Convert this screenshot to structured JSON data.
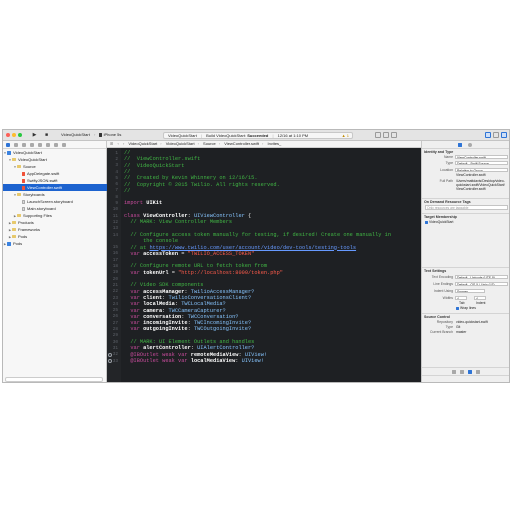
{
  "toolbar": {
    "scheme_target": "VideoQuickStart",
    "scheme_device": "iPhone 5s",
    "activity_app": "VideoQuickStart",
    "activity_status_prefix": "Build VideoQuickStart: ",
    "activity_status": "Succeeded",
    "activity_time": "12/16 at 1:10 PM",
    "warning_count": "1"
  },
  "navigator": {
    "rows": [
      {
        "label": "VideoQuickStart",
        "icon": "project-icon"
      },
      {
        "label": "VideoQuickStart",
        "icon": "folder-icon"
      },
      {
        "label": "Source",
        "icon": "folder-icon"
      },
      {
        "label": "AppDelegate.swift",
        "icon": "swift-file-icon"
      },
      {
        "label": "SwiftyJSON.swift",
        "icon": "swift-file-icon"
      },
      {
        "label": "ViewController.swift",
        "icon": "swift-file-icon"
      },
      {
        "label": "Storyboards",
        "icon": "folder-icon"
      },
      {
        "label": "LaunchScreen.storyboard",
        "icon": "file-icon"
      },
      {
        "label": "Main.storyboard",
        "icon": "file-icon"
      },
      {
        "label": "Supporting Files",
        "icon": "folder-icon"
      },
      {
        "label": "Products",
        "icon": "folder-icon"
      },
      {
        "label": "Frameworks",
        "icon": "folder-icon"
      },
      {
        "label": "Pods",
        "icon": "project-icon"
      },
      {
        "label": "Pods",
        "icon": "folder-icon"
      }
    ]
  },
  "jumpbar": {
    "items": [
      "VideoQuickStart",
      "VideoQuickStart",
      "Source",
      "ViewController.swift",
      "Invites_"
    ]
  },
  "editor": {
    "lines": [
      [
        {
          "t": "//",
          "c": "com"
        }
      ],
      [
        {
          "t": "//  ViewController.swift",
          "c": "com"
        }
      ],
      [
        {
          "t": "//  VideoQuickStart",
          "c": "com"
        }
      ],
      [
        {
          "t": "//",
          "c": "com"
        }
      ],
      [
        {
          "t": "//  Created by Kevin Whinnery on 12/16/15.",
          "c": "com"
        }
      ],
      [
        {
          "t": "//  Copyright © 2015 Twilio. All rights reserved.",
          "c": "com"
        }
      ],
      [
        {
          "t": "//",
          "c": "com"
        }
      ],
      [],
      [
        {
          "t": "import ",
          "c": "key"
        },
        {
          "t": "UIKit",
          "c": "bold"
        }
      ],
      [],
      [
        {
          "t": "class ",
          "c": "key"
        },
        {
          "t": "ViewController",
          "c": "bold"
        },
        {
          "t": ": ",
          "c": "ident"
        },
        {
          "t": "UIViewController",
          "c": "type"
        },
        {
          "t": " {",
          "c": "ident"
        }
      ],
      [
        {
          "t": "  // MARK: View Controller Members",
          "c": "com"
        }
      ],
      [],
      [
        {
          "t": "  // Configure access token manually for testing, if desired! Create one manually in",
          "c": "com"
        }
      ],
      [
        {
          "t": "      the console",
          "c": "com"
        }
      ],
      [
        {
          "t": "  // at ",
          "c": "com"
        },
        {
          "t": "https://www.twilio.com/user/account/video/dev-tools/testing-tools",
          "c": "link"
        }
      ],
      [
        {
          "t": "  var ",
          "c": "key"
        },
        {
          "t": "accessToken",
          "c": "bold"
        },
        {
          "t": " = ",
          "c": "ident"
        },
        {
          "t": "\"TWILIO_ACCESS_TOKEN\"",
          "c": "str"
        }
      ],
      [],
      [
        {
          "t": "  // Configure remote URL to fetch token from",
          "c": "com"
        }
      ],
      [
        {
          "t": "  var ",
          "c": "key"
        },
        {
          "t": "tokenUrl",
          "c": "bold"
        },
        {
          "t": " = ",
          "c": "ident"
        },
        {
          "t": "\"http://localhost:8000/token.php\"",
          "c": "str"
        }
      ],
      [],
      [
        {
          "t": "  // Video SDK components",
          "c": "com"
        }
      ],
      [
        {
          "t": "  var ",
          "c": "key"
        },
        {
          "t": "accessManager",
          "c": "bold"
        },
        {
          "t": ": ",
          "c": "ident"
        },
        {
          "t": "TwilioAccessManager?",
          "c": "type"
        }
      ],
      [
        {
          "t": "  var ",
          "c": "key"
        },
        {
          "t": "client",
          "c": "bold"
        },
        {
          "t": ": ",
          "c": "ident"
        },
        {
          "t": "TwilioConversationsClient?",
          "c": "type"
        }
      ],
      [
        {
          "t": "  var ",
          "c": "key"
        },
        {
          "t": "localMedia",
          "c": "bold"
        },
        {
          "t": ": ",
          "c": "ident"
        },
        {
          "t": "TWCLocalMedia?",
          "c": "type"
        }
      ],
      [
        {
          "t": "  var ",
          "c": "key"
        },
        {
          "t": "camera",
          "c": "bold"
        },
        {
          "t": ": ",
          "c": "ident"
        },
        {
          "t": "TWCCameraCapturer?",
          "c": "type"
        }
      ],
      [
        {
          "t": "  var ",
          "c": "key"
        },
        {
          "t": "conversation",
          "c": "bold"
        },
        {
          "t": ": ",
          "c": "ident"
        },
        {
          "t": "TWCConversation?",
          "c": "type"
        }
      ],
      [
        {
          "t": "  var ",
          "c": "key"
        },
        {
          "t": "incomingInvite",
          "c": "bold"
        },
        {
          "t": ": ",
          "c": "ident"
        },
        {
          "t": "TWCIncomingInvite?",
          "c": "type"
        }
      ],
      [
        {
          "t": "  var ",
          "c": "key"
        },
        {
          "t": "outgoingInvite",
          "c": "bold"
        },
        {
          "t": ": ",
          "c": "ident"
        },
        {
          "t": "TWCOutgoingInvite?",
          "c": "type"
        }
      ],
      [],
      [
        {
          "t": "  // MARK: UI Element Outlets and handles",
          "c": "com"
        }
      ],
      [
        {
          "t": "  var ",
          "c": "key"
        },
        {
          "t": "alertController",
          "c": "bold"
        },
        {
          "t": ": ",
          "c": "ident"
        },
        {
          "t": "UIAlertController?",
          "c": "type"
        }
      ],
      [
        {
          "t": "  @IBOutlet weak var ",
          "c": "key"
        },
        {
          "t": "remoteMediaView",
          "c": "bold"
        },
        {
          "t": ": ",
          "c": "ident"
        },
        {
          "t": "UIView!",
          "c": "type"
        }
      ],
      [
        {
          "t": "  @IBOutlet weak var ",
          "c": "key"
        },
        {
          "t": "localMediaView",
          "c": "bold"
        },
        {
          "t": ": ",
          "c": "ident"
        },
        {
          "t": "UIView!",
          "c": "type"
        }
      ]
    ],
    "line_numbers": [
      "1",
      "2",
      "3",
      "4",
      "5",
      "6",
      "7",
      "8",
      "9",
      "10",
      "11",
      "12",
      "13",
      "14",
      "",
      "15",
      "16",
      "17",
      "18",
      "19",
      "20",
      "21",
      "22",
      "23",
      "24",
      "25",
      "26",
      "27",
      "28",
      "29",
      "30",
      "31",
      "32",
      "33"
    ],
    "outlet_lines": [
      32,
      33
    ]
  },
  "inspector": {
    "identity_header": "Identity and Type",
    "name_label": "Name",
    "name_value": "ViewController.swift",
    "type_label": "Type",
    "type_value": "Default - Swift Source",
    "location_label": "Location",
    "location_value": "Relative to Group",
    "location_file": "ViewController.swift",
    "fullpath_label": "Full Path",
    "fullpath_value": "/Users/mattdavis/Desktop/video-quickstart-swift/VideoQuickStart/ViewController.swift",
    "ondemand_header": "On Demand Resource Tags",
    "ondemand_placeholder": "Only resources are taggable",
    "membership_header": "Target Membership",
    "membership_target": "VideoQuickStart",
    "textsettings_header": "Text Settings",
    "encoding_label": "Text Encoding",
    "encoding_value": "Default - Unicode (UTF-8)",
    "lineendings_label": "Line Endings",
    "lineendings_value": "Default - OS X / Unix (LF)",
    "indent_label": "Indent Using",
    "indent_value": "Spaces",
    "widths_label": "Widths",
    "tab_width": "4",
    "indent_width": "4",
    "tab_label": "Tab",
    "indentw_label": "Indent",
    "wrap_label": "Wrap lines",
    "sourcecontrol_header": "Source Control",
    "repository_label": "Repository",
    "repository_value": "video-quickstart-swift",
    "sc_type_label": "Type",
    "sc_type_value": "Git",
    "branch_label": "Current Branch",
    "branch_value": "master"
  }
}
